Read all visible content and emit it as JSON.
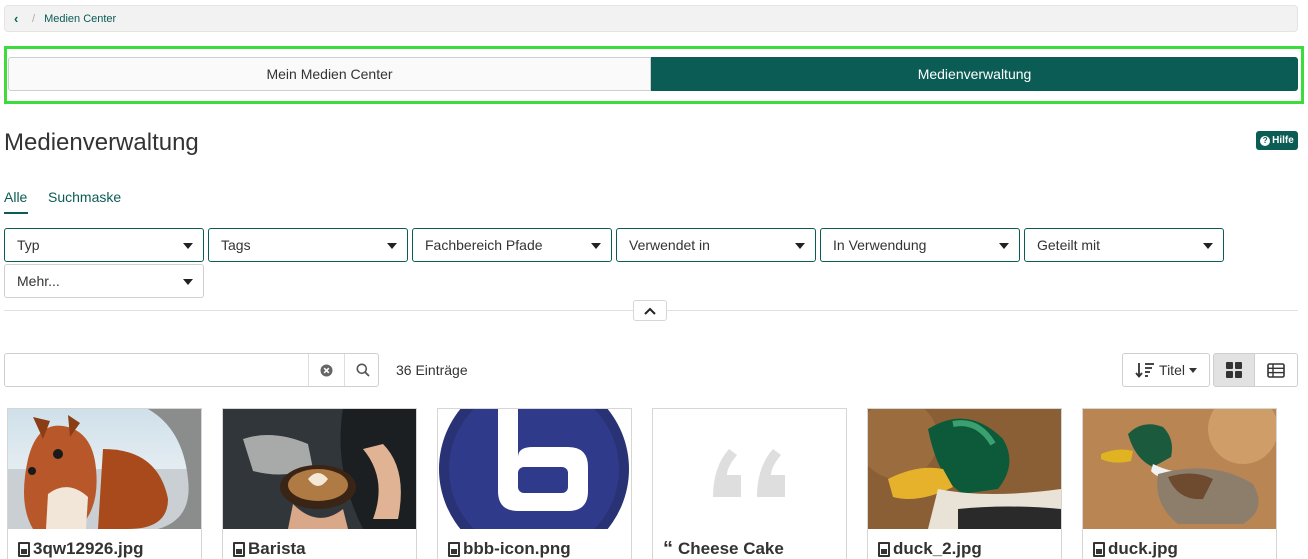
{
  "breadcrumb": {
    "current": "Medien Center"
  },
  "segments": {
    "left": "Mein Medien Center",
    "right": "Medienverwaltung"
  },
  "page": {
    "title": "Medienverwaltung",
    "help_label": "Hilfe"
  },
  "tabs": [
    {
      "label": "Alle"
    },
    {
      "label": "Suchmaske"
    }
  ],
  "filters": [
    {
      "label": "Typ"
    },
    {
      "label": "Tags"
    },
    {
      "label": "Fachbereich Pfade"
    },
    {
      "label": "Verwendet in"
    },
    {
      "label": "In Verwendung"
    },
    {
      "label": "Geteilt mit"
    },
    {
      "label": "Mehr..."
    }
  ],
  "search": {
    "value": "",
    "placeholder": ""
  },
  "results": {
    "count_label": "36 Einträge"
  },
  "sort": {
    "label": "Titel"
  },
  "cards": [
    {
      "title": "3qw12926.jpg",
      "icon": "image-file-icon"
    },
    {
      "title": "Barista",
      "icon": "image-file-icon"
    },
    {
      "title": "bbb-icon.png",
      "icon": "image-file-icon"
    },
    {
      "title": "Cheese Cake",
      "icon": "quote-icon"
    },
    {
      "title": "duck_2.jpg",
      "icon": "image-file-icon"
    },
    {
      "title": "duck.jpg",
      "icon": "image-file-icon"
    }
  ],
  "colors": {
    "accent": "#0b5c55",
    "highlight": "#3cdc3c"
  }
}
